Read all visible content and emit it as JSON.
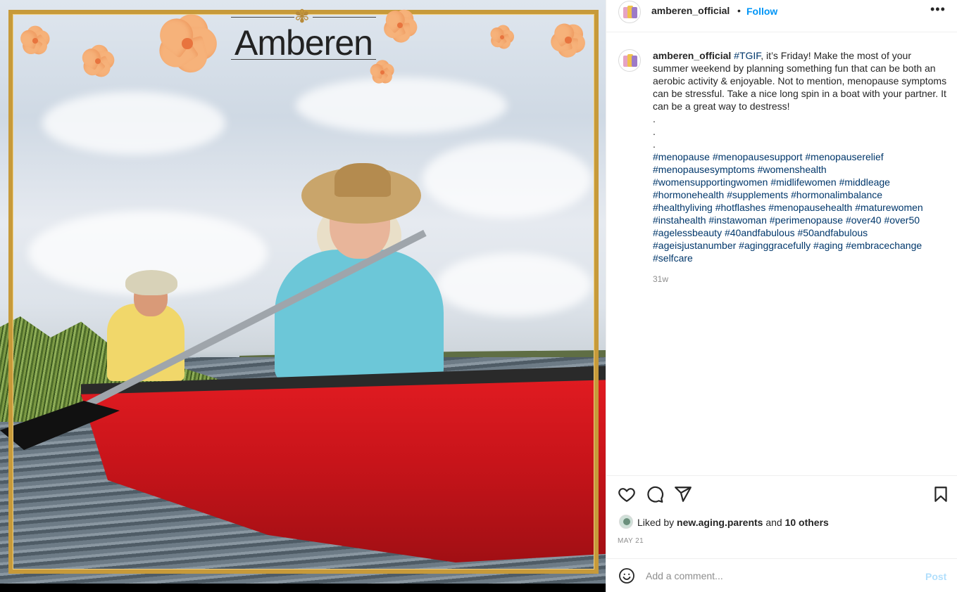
{
  "post_image": {
    "brand_logo_text": "Amberen"
  },
  "header": {
    "username": "amberen_official",
    "separator": "•",
    "follow_label": "Follow",
    "more_label": "•••"
  },
  "caption": {
    "username": "amberen_official",
    "hashtag_tgif": "#TGIF",
    "body": ", it’s Friday! Make the most of your summer weekend by planning something fun that can be both an aerobic activity & enjoyable. Not to mention, menopause symptoms can be stressful. Take a nice long spin in a boat with your partner. It can be a great way to destress!",
    "dots": [
      ".",
      ".",
      "."
    ],
    "hashtags": [
      "#menopause #menopausesupport #menopauserelief",
      "#menopausesymptoms #womenshealth",
      "#womensupportingwomen #midlifewomen #middleage",
      "#hormonehealth #supplements #hormonalimbalance",
      "#healthyliving #hotflashes #menopausehealth #maturewomen",
      "#instahealth #instawoman #perimenopause #over40 #over50",
      "#agelessbeauty #40andfabulous #50andfabulous",
      "#ageisjustanumber #aginggracefully #aging #embracechange",
      "#selfcare"
    ],
    "time_ago": "31w"
  },
  "actions": {
    "like_icon": "heart-icon",
    "comment_icon": "comment-icon",
    "share_icon": "share-icon",
    "save_icon": "bookmark-icon"
  },
  "likes": {
    "prefix": "Liked by ",
    "user": "new.aging.parents",
    "middle": " and ",
    "others": "10 others"
  },
  "date": "MAY 21",
  "comment": {
    "placeholder": "Add a comment...",
    "post_label": "Post"
  },
  "colors": {
    "link_blue": "#0095f6",
    "hashtag": "#00376b",
    "post_disabled": "#b2dffc",
    "frame_gold": "#c79a3a"
  }
}
